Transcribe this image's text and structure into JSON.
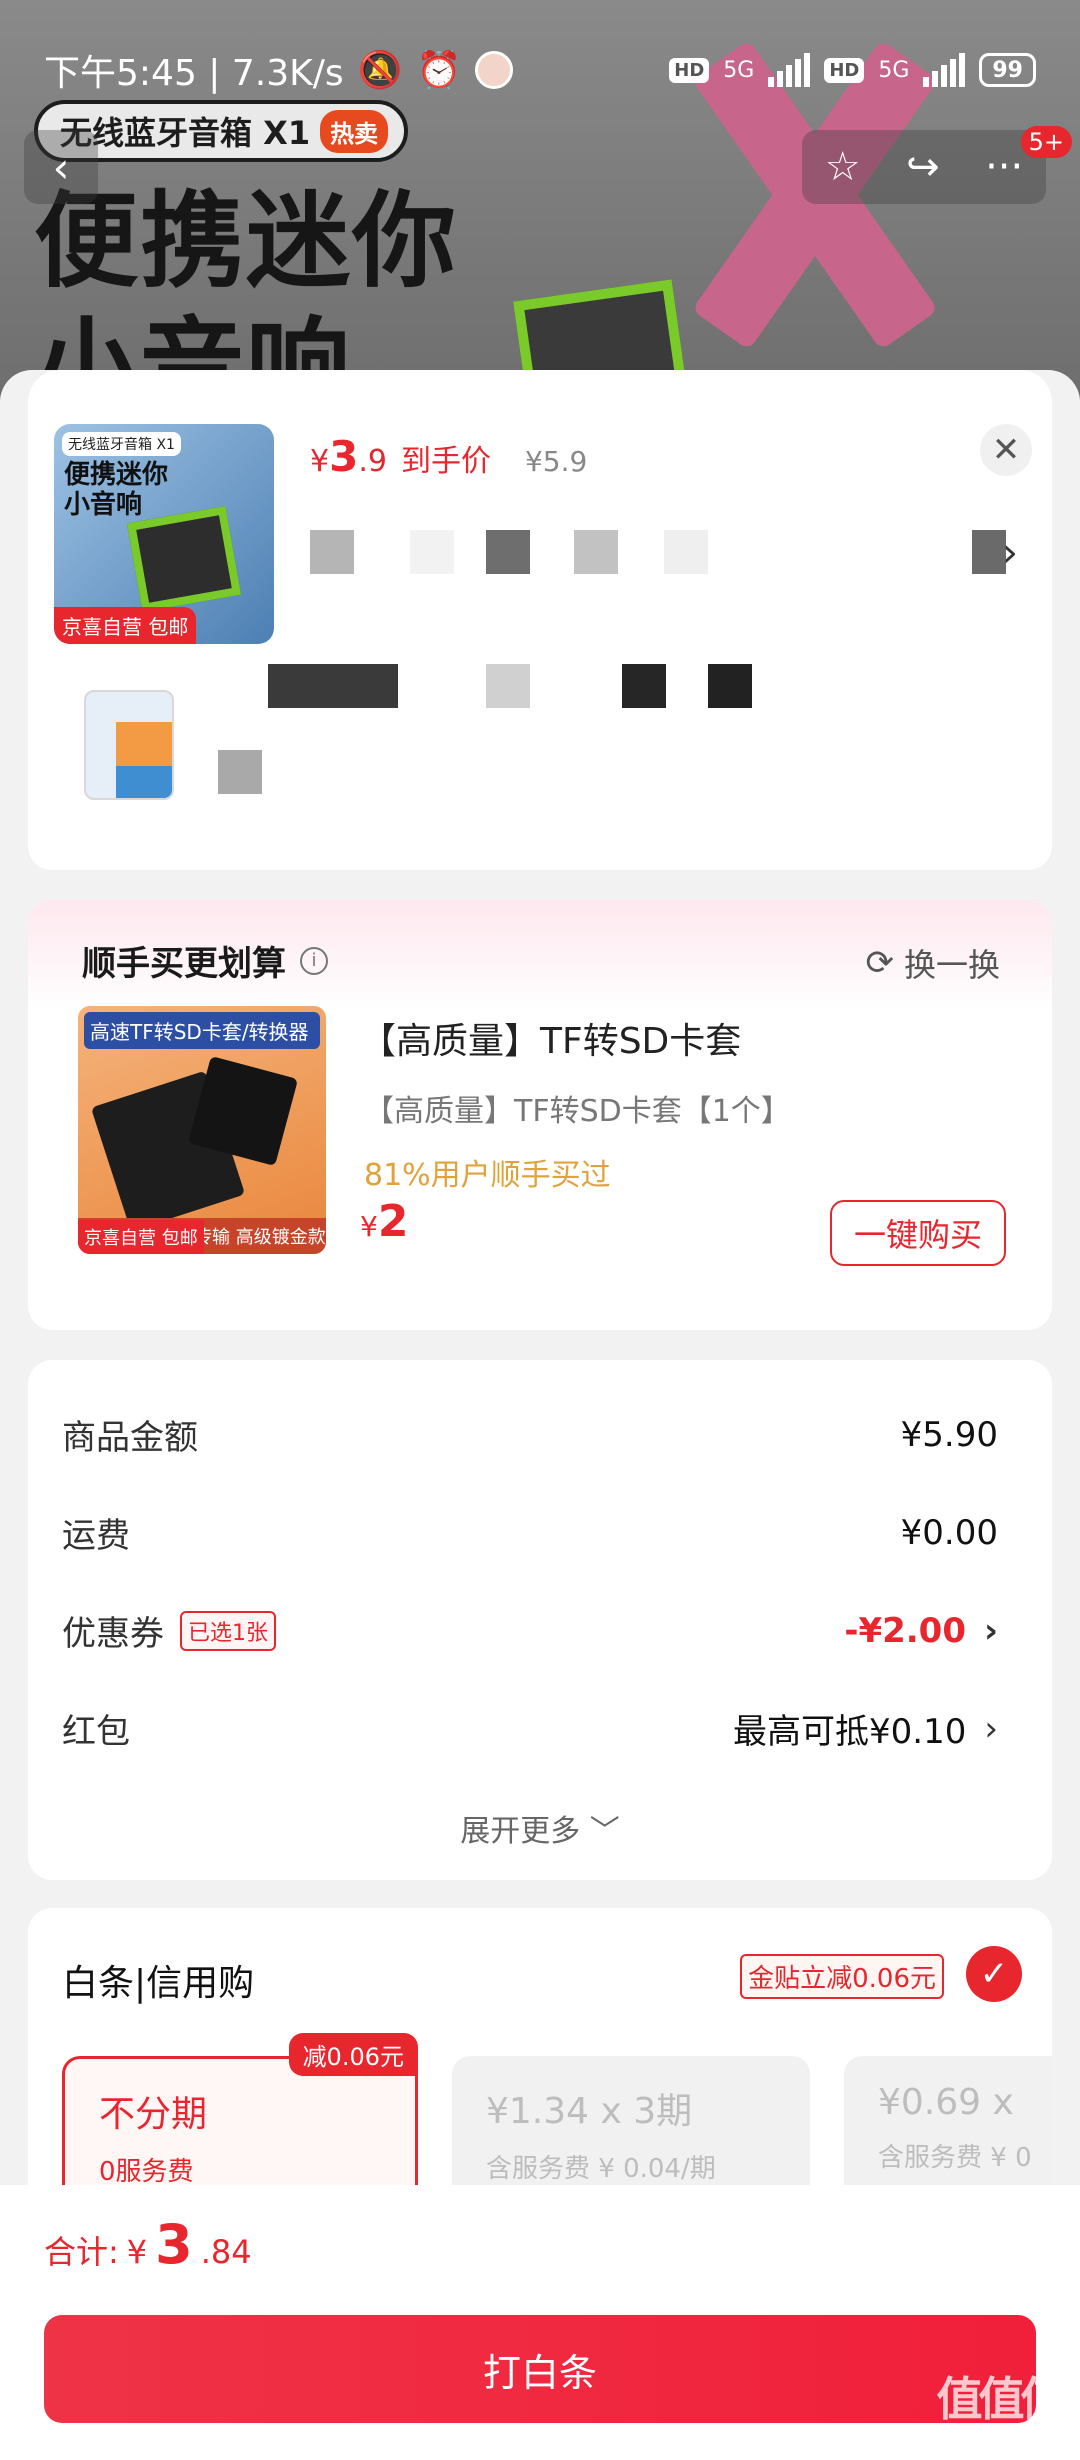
{
  "status_bar": {
    "time_speed": "下午5:45 | 7.3K/s",
    "network1": "5G",
    "network2": "5G",
    "hd": "HD",
    "battery": "99"
  },
  "backdrop": {
    "banner": "无线蓝牙音箱 X1",
    "banner_hot": "热卖",
    "title_line1": "便携迷你",
    "title_line2": "小音响"
  },
  "topbar": {
    "back_icon": "‹",
    "star_icon": "☆",
    "share_icon": "↪",
    "more_icon": "···",
    "badge": "5+"
  },
  "product": {
    "thumb_banner": "无线蓝牙音箱 X1",
    "thumb_title": "便携迷你小音响",
    "thumb_tag": "京喜自营 包邮",
    "price_prefix": "¥",
    "price_int": "3",
    "price_dec": ".9",
    "price_label": "到手价",
    "orig_price": "¥5.9"
  },
  "addon": {
    "title": "顺手买更划算",
    "swap_label": "换一换",
    "img_header": "高速TF转SD卡套/转换器",
    "img_footer": "稳定传输  高级镀金款",
    "img_tag": "京喜自营 包邮",
    "name": "【高质量】TF转SD卡套",
    "sub": "【高质量】TF转SD卡套【1个】",
    "stat": "81%用户顺手买过",
    "price_symbol": "¥",
    "price": "2",
    "buy_label": "一键购买"
  },
  "summary": {
    "goods_label": "商品金额",
    "goods_value": "¥5.90",
    "freight_label": "运费",
    "freight_value": "¥0.00",
    "coupon_label": "优惠券",
    "coupon_badge": "已选1张",
    "coupon_value": "-¥2.00",
    "redpacket_label": "红包",
    "redpacket_value": "最高可抵¥0.10",
    "expand_label": "展开更多 ﹀"
  },
  "pay": {
    "title": "白条|信用购",
    "discount": "金贴立减0.06元",
    "plans": [
      {
        "name": "不分期",
        "fee": "0服务费",
        "badge": "减0.06元"
      },
      {
        "name": "¥1.34 x 3期",
        "fee": "含服务费 ¥ 0.04/期"
      },
      {
        "name": "¥0.69 x",
        "fee": "含服务费 ¥ 0"
      }
    ]
  },
  "bottom": {
    "total_label": "合计:",
    "total_symbol": "¥",
    "total_int": "3",
    "total_dec": ".84",
    "submit_label": "打白条",
    "watermark": "值值值",
    "watermark_url": "zhizhizhi.com"
  },
  "colors": {
    "accent": "#e8262e",
    "background": "#f2f2f2"
  }
}
